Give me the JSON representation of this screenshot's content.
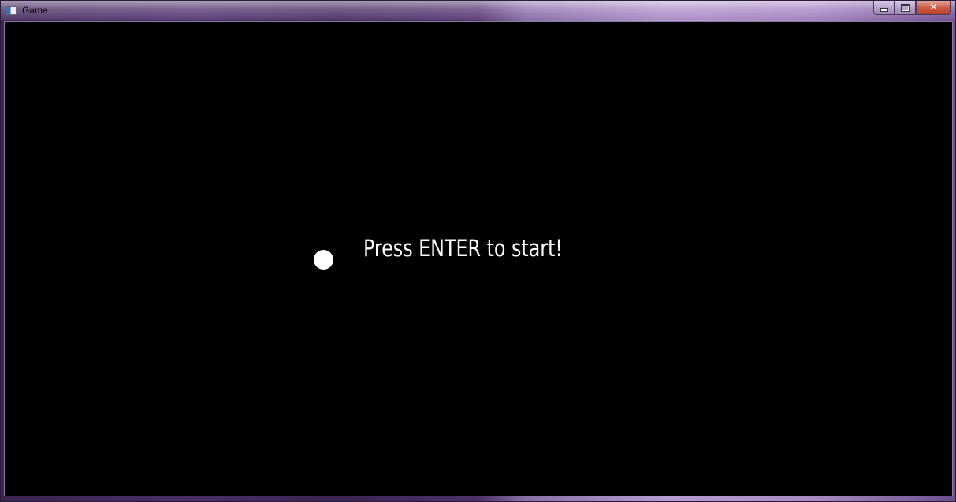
{
  "window": {
    "title": "Game",
    "controls": {
      "minimize_icon": "minimize-icon",
      "maximize_icon": "maximize-icon",
      "close_label": "✕"
    }
  },
  "game": {
    "background_color": "#000000",
    "ball_color": "#ffffff",
    "prompt": "Press ENTER to start!"
  }
}
